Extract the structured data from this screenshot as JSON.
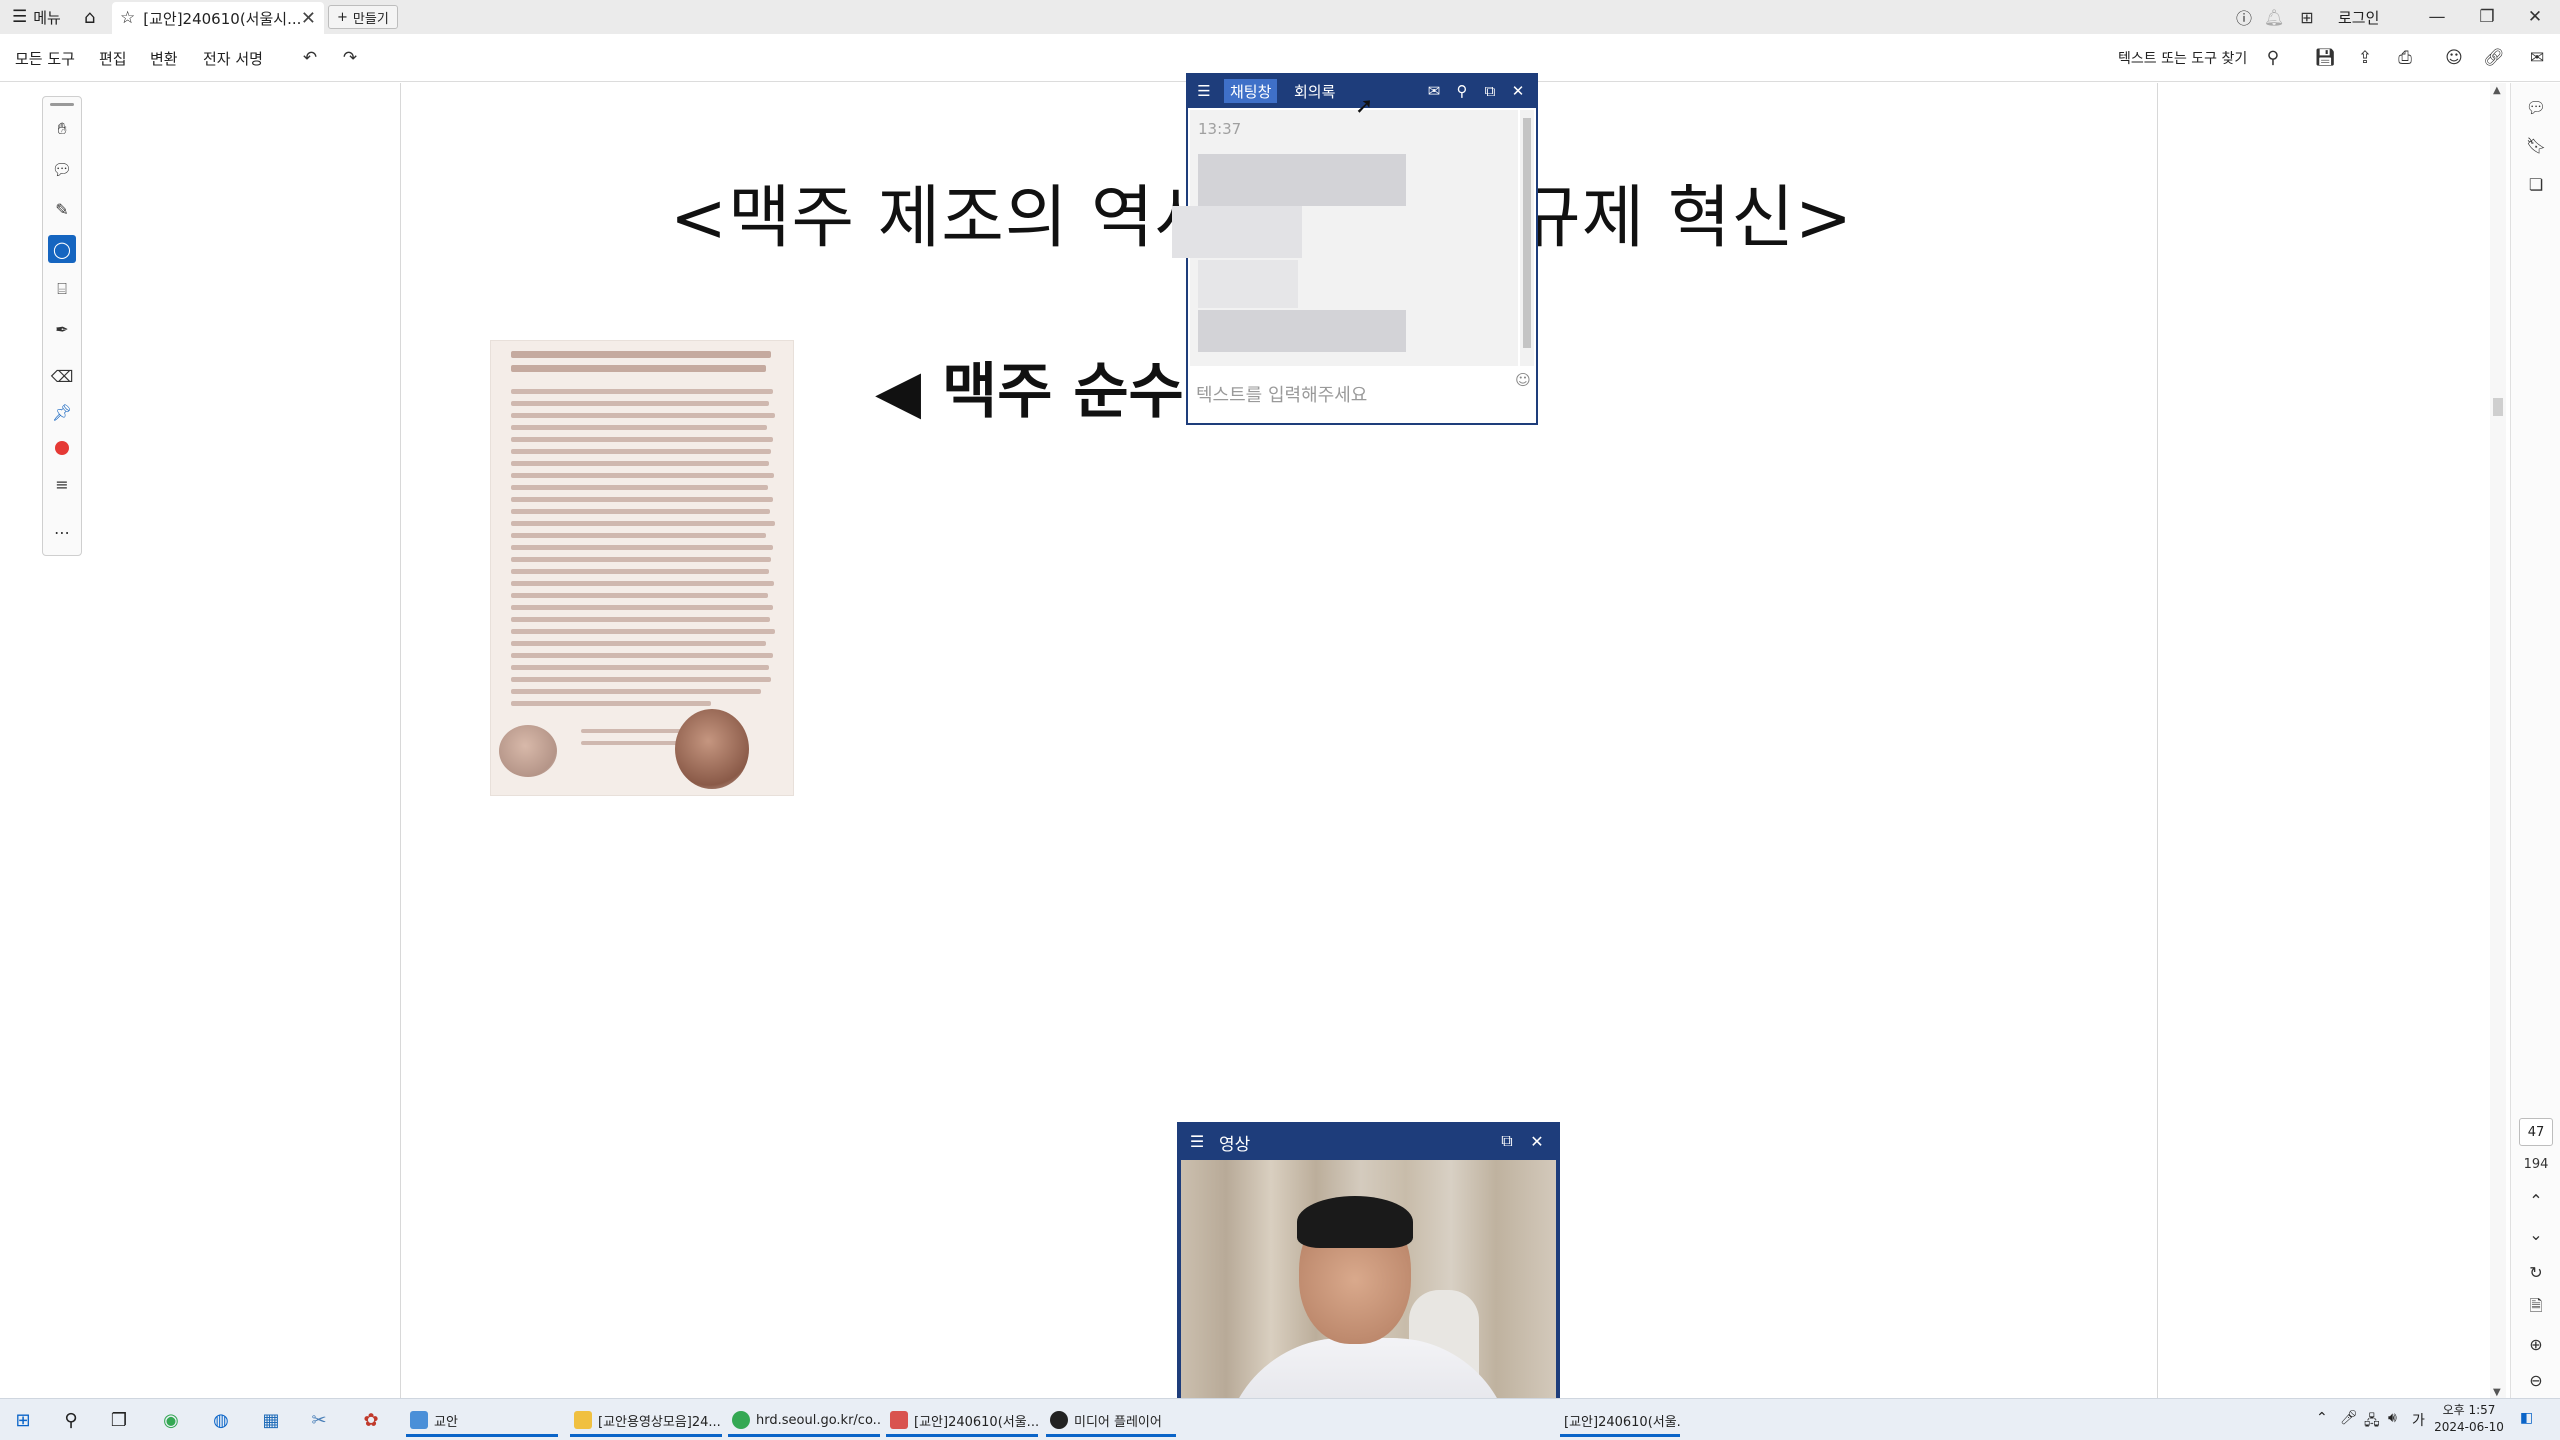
{
  "titlebar": {
    "menu_label": "메뉴",
    "active_tab_title": "[교안]240610(서울시...",
    "new_tab_label": "만들기",
    "login_label": "로그인"
  },
  "menubar": {
    "items": [
      "모든 도구",
      "편집",
      "변환",
      "전자 서명"
    ],
    "search_label": "텍스트 또는 도구 찾기"
  },
  "document": {
    "title": "<맥주 제조의 역사",
    "title_tail": "규제 혁신>",
    "subtitle": "◀ 맥주 순수령",
    "current_page": "47",
    "total_pages": "194"
  },
  "chat": {
    "tab_chat": "채팅창",
    "tab_minutes": "회의록",
    "time": "13:37",
    "input_placeholder": "텍스트를 입력해주세요"
  },
  "video": {
    "title": "영상"
  },
  "taskbar": {
    "apps": [
      {
        "label": "교안",
        "color": "#4a8fd8"
      },
      {
        "label": "[교안용영상모음]24...",
        "color": "#f0c040"
      },
      {
        "label": "hrd.seoul.go.kr/co...",
        "color": "#34a853"
      },
      {
        "label": "[교안]240610(서울...",
        "color": "#d9534f"
      },
      {
        "label": "미디어 플레이어",
        "color": "#222222"
      },
      {
        "label": "[교안]240610(서울...",
        "color": "#d9534f"
      }
    ],
    "ime_label": "가",
    "clock_time": "오후 1:57",
    "clock_date": "2024-06-10"
  },
  "colors": {
    "accent": "#1565c0",
    "chat_header": "#1e3d7b",
    "chat_tab_active": "#3f70c8",
    "record_red": "#e53935"
  }
}
